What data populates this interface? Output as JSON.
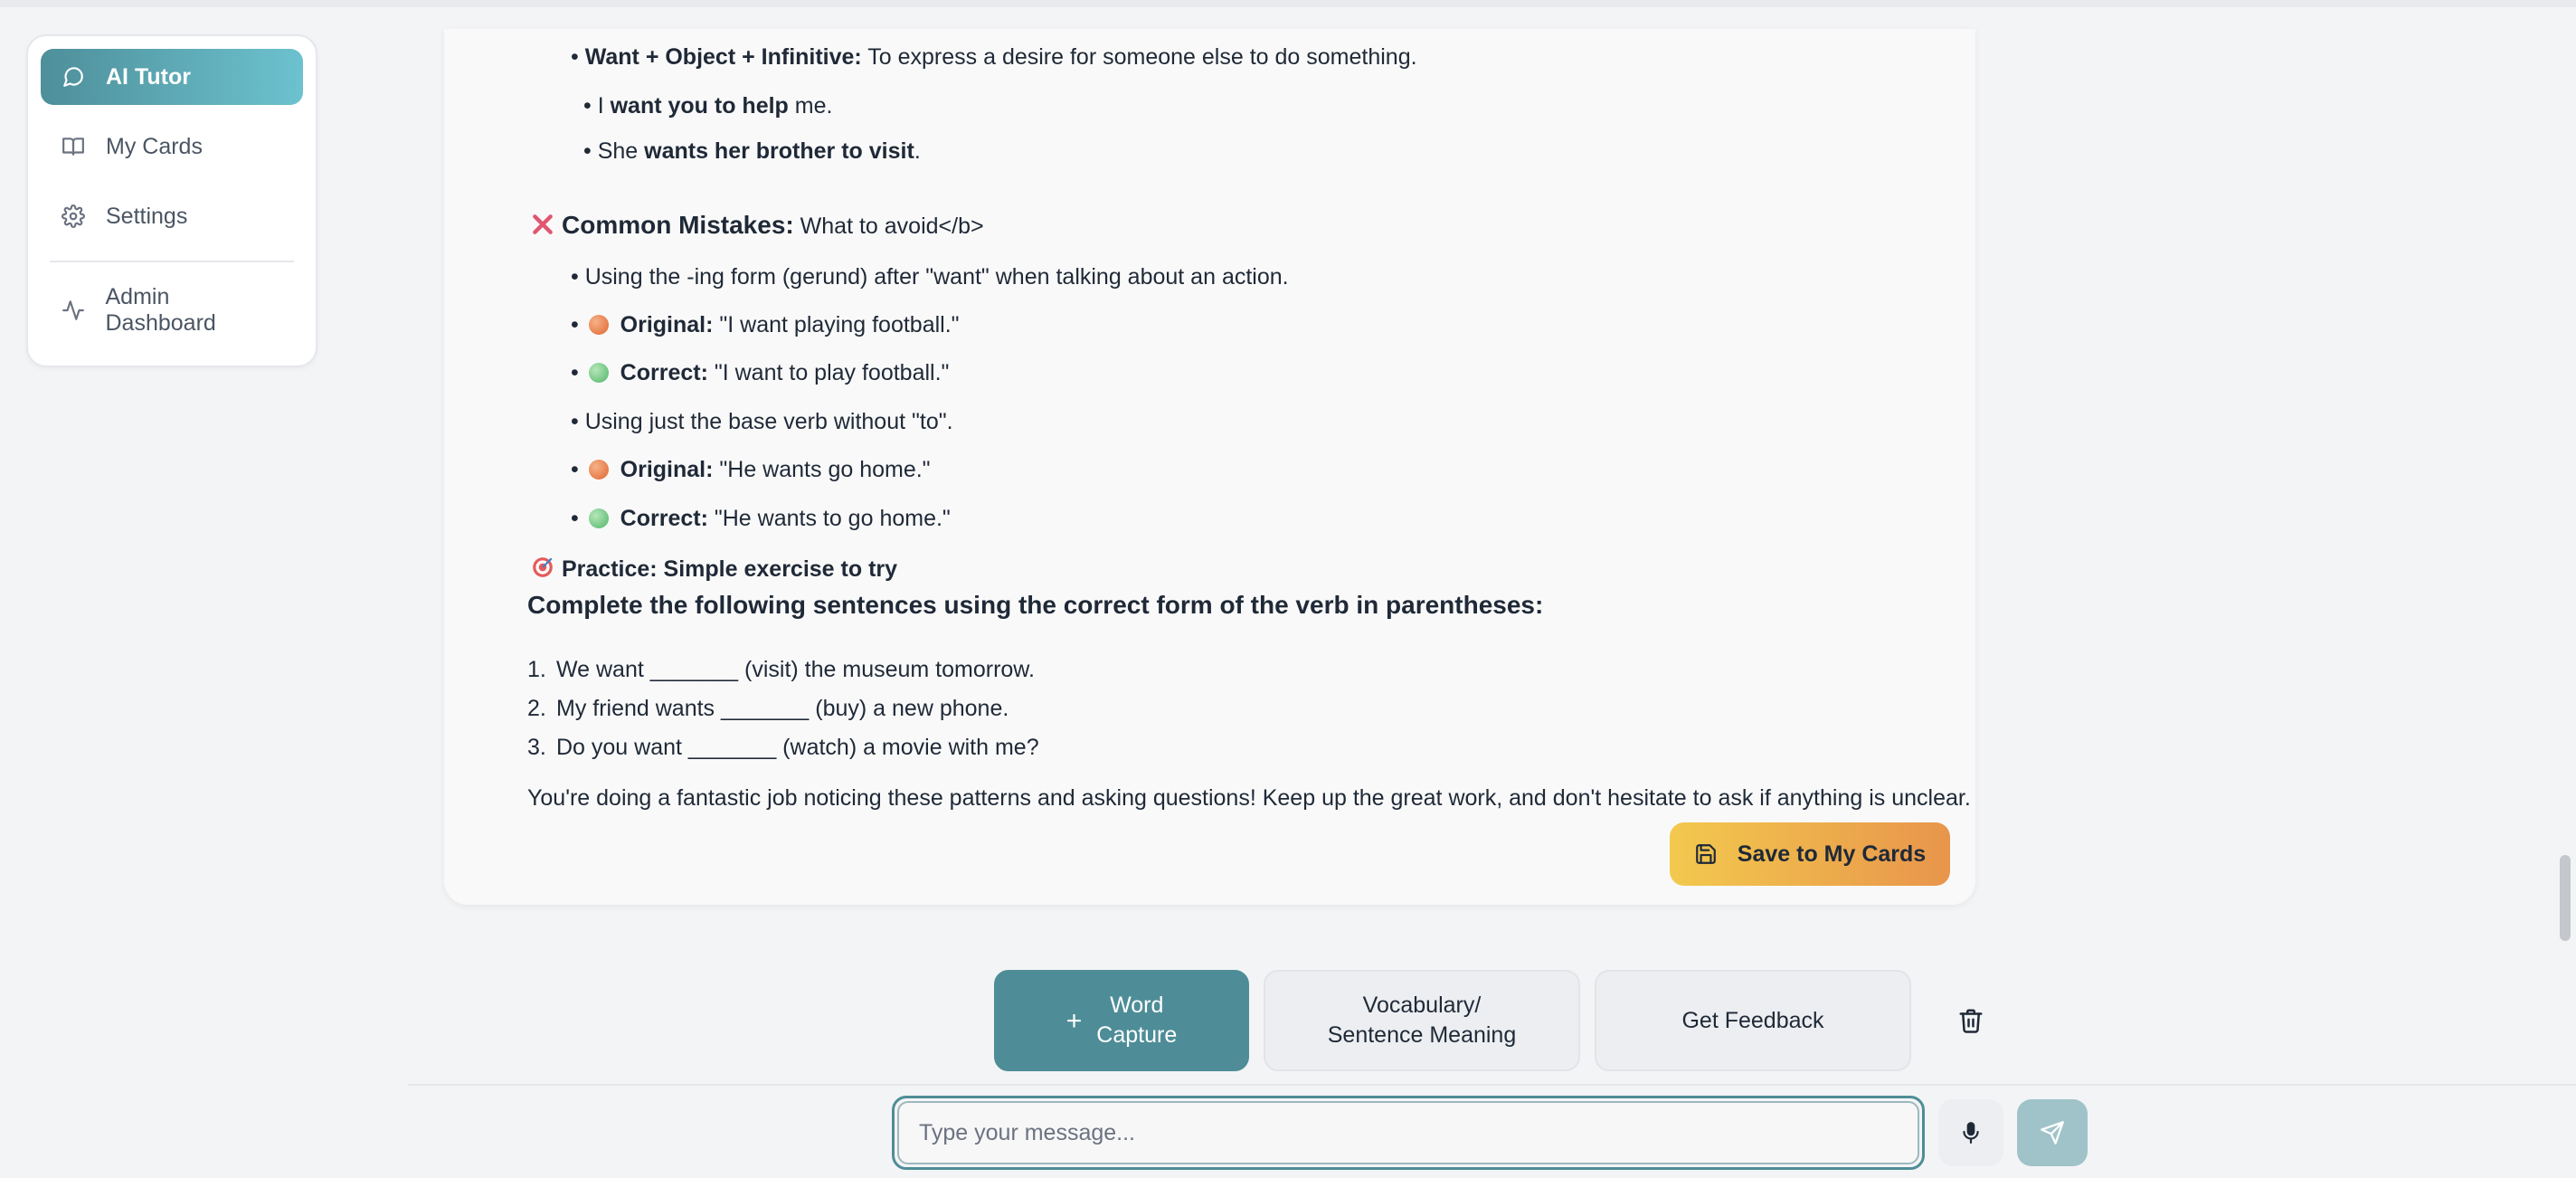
{
  "sidebar": {
    "items": [
      {
        "label": "AI Tutor",
        "icon": "chat-bubble-icon"
      },
      {
        "label": "My Cards",
        "icon": "book-icon"
      },
      {
        "label": "Settings",
        "icon": "gear-icon"
      },
      {
        "label": "Admin Dashboard",
        "icon": "activity-icon"
      }
    ]
  },
  "lesson": {
    "rule_title": "Want + Object + Infinitive:",
    "rule_desc": "To express a desire for someone else to do something.",
    "ex1_pre": "I ",
    "ex1_bold": "want you to help",
    "ex1_post": " me.",
    "ex2_pre": "She ",
    "ex2_bold": "wants her brother to visit",
    "ex2_post": ".",
    "mistakes_title": "Common Mistakes:",
    "mistakes_desc": "What to avoid</b>",
    "m1": "Using the -ing form (gerund) after \"want\" when talking about an action.",
    "m1_orig_label": "Original:",
    "m1_orig": "\"I want playing football.\"",
    "m1_corr_label": "Correct:",
    "m1_corr": "\"I want to play football.\"",
    "m2": "Using just the base verb without \"to\".",
    "m2_orig_label": "Original:",
    "m2_orig": "\"He wants go home.\"",
    "m2_corr_label": "Correct:",
    "m2_corr": "\"He wants to go home.\"",
    "practice_title": "Practice: Simple exercise to try",
    "practice_heading": "Complete the following sentences using the correct form of the verb in parentheses:",
    "exercises": [
      {
        "num": "1.",
        "text": "We want _______ (visit) the museum tomorrow."
      },
      {
        "num": "2.",
        "text": "My friend wants _______ (buy) a new phone."
      },
      {
        "num": "3.",
        "text": "Do you want _______ (watch) a movie with me?"
      }
    ],
    "closing": "You're doing a fantastic job noticing these patterns and asking questions! Keep up the great work, and don't hesitate to ask if anything is unclear."
  },
  "save_button": "Save to My Cards",
  "actions": {
    "word_capture_1": "Word",
    "word_capture_2": "Capture",
    "vocab_1": "Vocabulary/",
    "vocab_2": "Sentence Meaning",
    "feedback": "Get Feedback"
  },
  "input": {
    "placeholder": "Type your message..."
  },
  "colors": {
    "accent": "#4e8d97",
    "save_start": "#f3c94e",
    "save_end": "#e8954b"
  }
}
